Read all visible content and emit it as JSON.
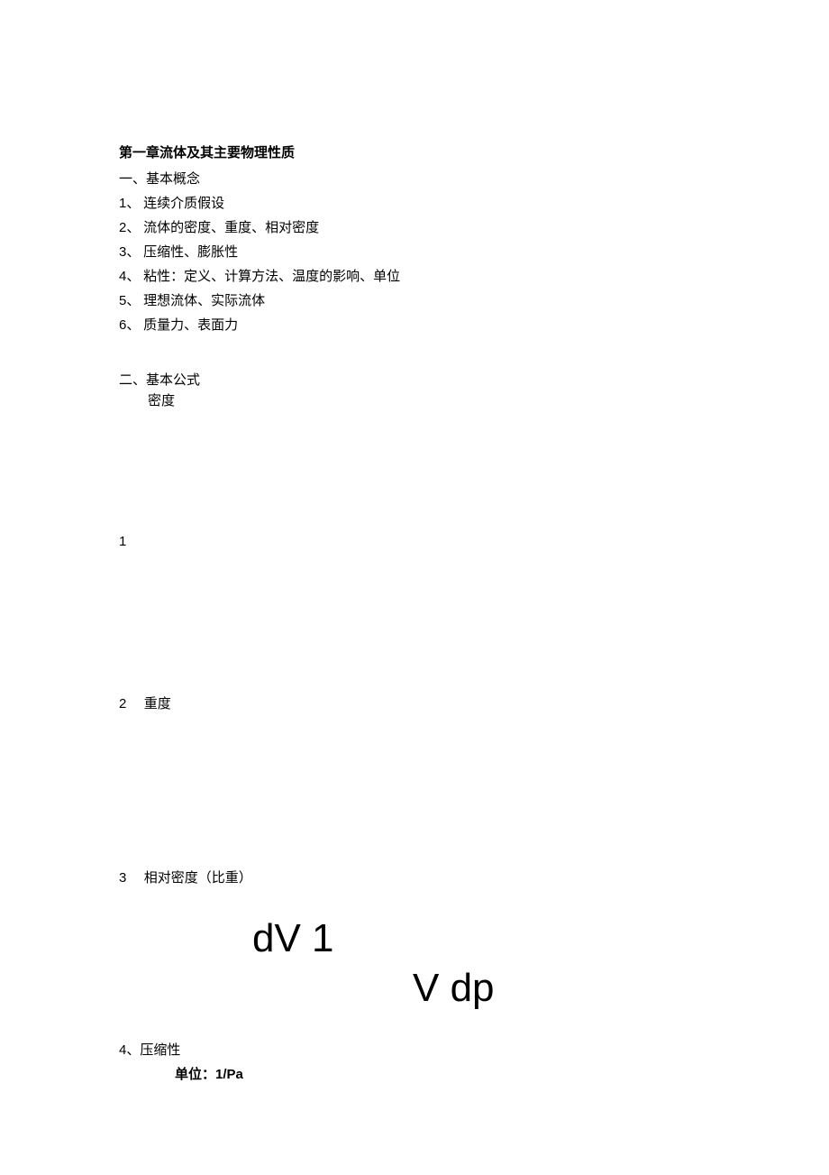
{
  "chapter_title": "第一章流体及其主要物理性质",
  "section1": {
    "heading": "一、基本概念",
    "items": [
      {
        "num": "1、",
        "text": "连续介质假设"
      },
      {
        "num": "2、",
        "text": "流体的密度、重度、相对密度"
      },
      {
        "num": "3、",
        "text": "压缩性、膨胀性"
      },
      {
        "num": "4、",
        "text": "粘性：定义、计算方法、温度的影响、单位"
      },
      {
        "num": "5、",
        "text": "理想流体、实际流体"
      },
      {
        "num": "6、",
        "text": "质量力、表面力"
      }
    ]
  },
  "section2": {
    "heading": "二、基本公式",
    "sub": "密度",
    "row1_num": "1",
    "row2": {
      "num": "2",
      "label": "重度"
    },
    "row3": {
      "num": "3",
      "label": "相对密度（比重）"
    },
    "formula": {
      "line1": "dV 1",
      "line2": "V dp"
    },
    "row4": {
      "num": "4、",
      "label": "压缩性"
    },
    "unit": {
      "label": "单位：",
      "value": "1/Pa"
    }
  }
}
